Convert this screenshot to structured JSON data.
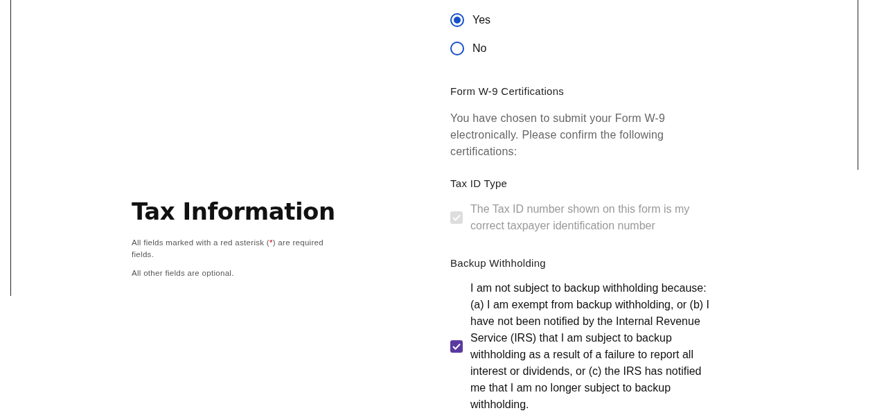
{
  "intro": {
    "title": "Tax Information",
    "required_note": {
      "before": "All fields marked with a red asterisk (",
      "mark": "*",
      "after": ") are required fields."
    },
    "optional_note": "All other fields are optional."
  },
  "radios": [
    {
      "label": "Yes",
      "selected": true
    },
    {
      "label": "No",
      "selected": false
    }
  ],
  "certifications": {
    "title": "Form W-9 Certifications",
    "description": "You have chosen to submit your Form W-9 electronically. Please confirm the following certifications:"
  },
  "sections": [
    {
      "title": "Tax ID Type",
      "checkbox": {
        "label": "The Tax ID number shown on this form is my correct taxpayer identification number",
        "checked": true,
        "disabled": true
      }
    },
    {
      "title": "Backup Withholding",
      "checkbox": {
        "label": "I am not subject to backup withholding because: (a) I am exempt from backup withholding, or (b) I have not been notified by the Internal Revenue Service (IRS) that I am subject to backup withholding as a result of a failure to report all interest or dividends, or (c) the IRS has notified me that I am no longer subject to backup withholding.",
        "checked": true,
        "disabled": false
      }
    }
  ]
}
